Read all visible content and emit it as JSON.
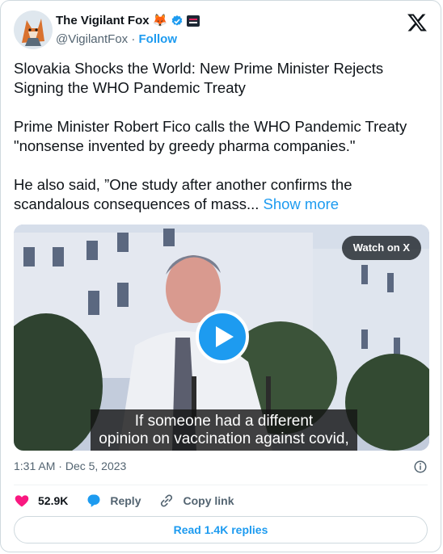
{
  "author": {
    "display_name": "The Vigilant Fox",
    "emoji": "🦊",
    "handle": "@VigilantFox",
    "separator": "·",
    "follow_label": "Follow"
  },
  "tweet": {
    "text_lines": [
      "Slovakia Shocks the World: New Prime Minister Rejects",
      "Signing the WHO Pandemic Treaty",
      "",
      "Prime Minister Robert Fico calls the WHO Pandemic Treaty",
      "\"nonsense invented by greedy pharma companies.\"",
      "",
      "He also said, ”One study after another confirms the",
      "scandalous consequences of mass..."
    ],
    "show_more_label": " Show more"
  },
  "media": {
    "watch_label": "Watch on X",
    "caption_lines": [
      "If someone had a different",
      "opinion on vaccination against covid,"
    ]
  },
  "meta": {
    "time": "1:31 AM",
    "dot": "·",
    "date": "Dec 5, 2023"
  },
  "actions": {
    "like_count": "52.9K",
    "reply_label": "Reply",
    "copy_label": "Copy link"
  },
  "footer": {
    "read_replies_label": "Read 1.4K replies"
  },
  "colors": {
    "accent": "#1d9bf0",
    "like": "#f91880",
    "text": "#0f1419",
    "muted": "#536471"
  },
  "icons": [
    "fox-avatar-icon",
    "verified-badge-icon",
    "affiliate-badge-icon",
    "x-logo-icon",
    "play-icon",
    "info-icon",
    "heart-icon",
    "reply-bubble-icon",
    "link-icon"
  ]
}
